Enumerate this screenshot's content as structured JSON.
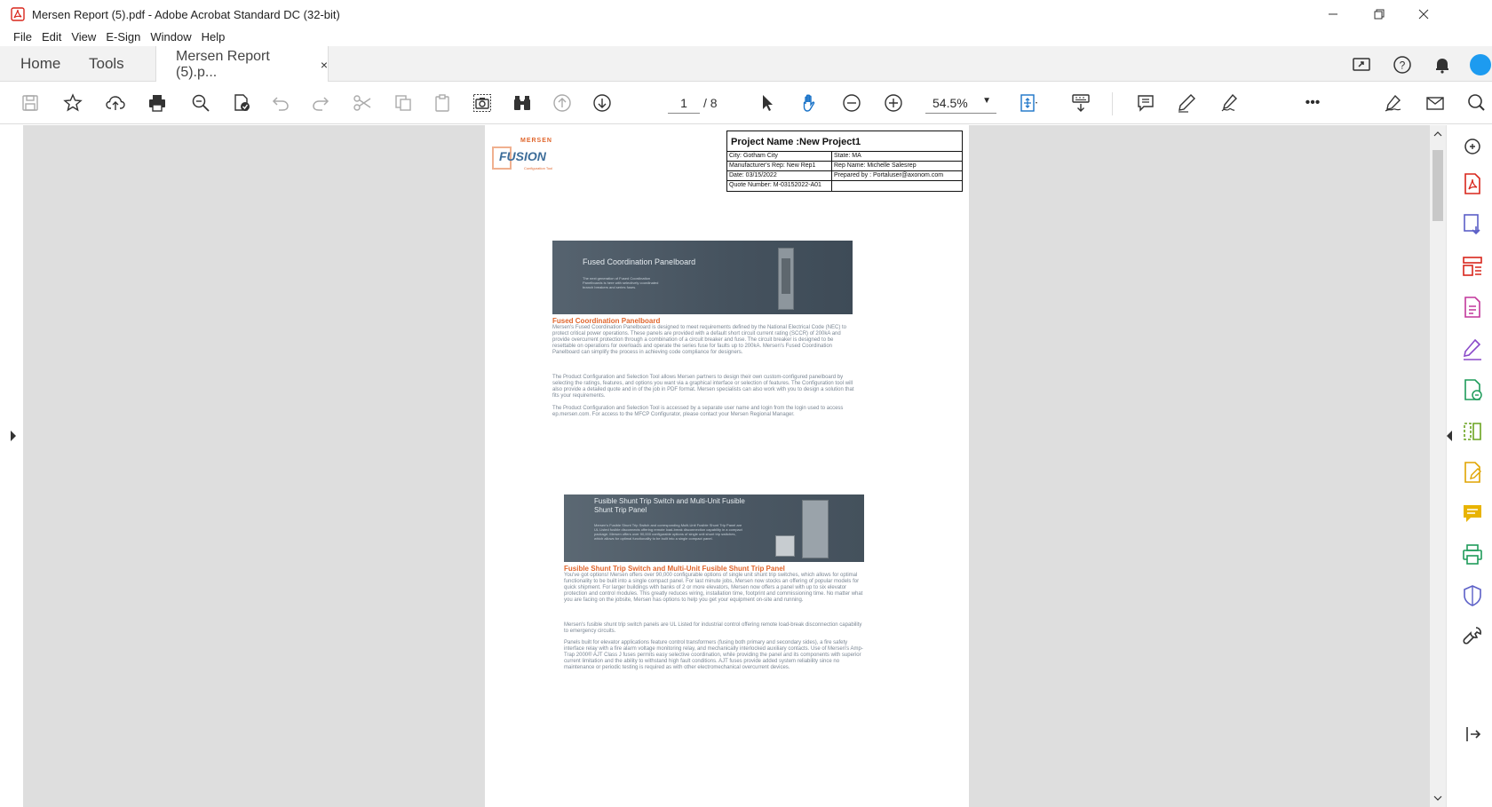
{
  "window": {
    "title": "Mersen Report (5).pdf - Adobe Acrobat Standard DC (32-bit)"
  },
  "menu": [
    "File",
    "Edit",
    "View",
    "E-Sign",
    "Window",
    "Help"
  ],
  "tabs": {
    "home": "Home",
    "tools": "Tools",
    "document": "Mersen Report (5).p...",
    "close": "×"
  },
  "toolbar": {
    "page_current": "1",
    "page_total": "/ 8",
    "zoom": "54.5%",
    "more": "•••"
  },
  "colors": {
    "accent_orange": "#e0662d",
    "banner": "#4d5a66",
    "viewport": "#dedede"
  },
  "document": {
    "logo": {
      "brand": "MERSEN",
      "product": "FUSION",
      "sub": "Configuration Tool"
    },
    "project": {
      "title": "Project Name :New Project1",
      "rows": [
        [
          "City: Gotham City",
          "State: MA"
        ],
        [
          "Manufacturer's Rep: New Rep1",
          "Rep Name: Michelle Salesrep"
        ],
        [
          "Date: 03/15/2022",
          "Prepared by : Portaluser@axonom.com"
        ],
        [
          "Quote Number: M-03152022-A01",
          ""
        ]
      ]
    },
    "section1": {
      "banner_title": "Fused Coordination Panelboard",
      "banner_text": "The next generation of Fused Coordination Panelboards is here with selectively coordinated branch breakers and series fuses.",
      "title": "Fused Coordination Panelboard",
      "p1": "Mersen's Fused Coordination Panelboard is designed to meet requirements defined by the National Electrical Code (NEC) to protect critical power operations. These panels are provided with a default short circuit current rating (SCCR) of 200kA and provide overcurrent protection through a combination of a circuit breaker and fuse. The circuit breaker is designed to be resettable on operations for overloads and operate the series fuse for faults up to 200kA. Mersen's Fused Coordination Panelboard can simplify the process in achieving code compliance for designers.",
      "p2": "The Product Configuration and Selection Tool allows Mersen partners to design their own custom-configured panelboard by selecting the ratings, features, and options you want via a graphical interface or selection of features. The Configuration tool will also provide a detailed quote and in of the job in PDF format. Mersen specialists can also work with you to design a solution that fits your requirements.",
      "p3": "The Product Configuration and Selection Tool is accessed by a separate user name and login from the login used to access ep.mersen.com. For access to the MFCP Configurator, please contact your Mersen Regional Manager."
    },
    "section2": {
      "banner_title": "Fusible Shunt Trip Switch and Multi-Unit Fusible Shunt Trip Panel",
      "banner_text": "Mersen's Fusible Shunt Trip Switch and corresponding Multi-Unit Fusible Shunt Trip Panel are UL Listed fusible disconnects offering remote load-break disconnection capability in a compact package. Mersen offers over 90,000 configurable options of single unit shunt trip switches, which allows for optimal functionality to be built into a single compact panel.",
      "title": "Fusible Shunt Trip Switch and Multi-Unit Fusible Shunt Trip Panel",
      "p1": "You've got options! Mersen offers over 90,000 configurable options of single unit shunt trip switches, which allows for optimal functionality to be built into a single compact panel. For last minute jobs, Mersen now stocks an offering of popular models for quick shipment. For larger buildings with banks of 2 or more elevators, Mersen now offers a panel with up to six elevator protection and control modules. This greatly reduces wiring, installation time, footprint and commissioning time. No matter what you are facing on the jobsite, Mersen has options to help you get your equipment on-site and running.",
      "p2": "Mersen's fusible shunt trip switch panels are UL Listed for industrial control offering remote load-break disconnection capability to emergency circuits.",
      "p3": "Panels built for elevator applications feature control transformers (fusing both primary and secondary sides), a fire safety interface relay with a fire alarm voltage monitoring relay, and mechanically interlocked auxiliary contacts. Use of Mersen's Amp-Trap 2000® AJT Class J fuses permits easy selective coordination, while providing the panel and its components with superior current limitation and the ability to withstand high fault conditions. AJT fuses provide added system reliability since no maintenance or periodic testing is required as with other electromechanical overcurrent devices."
    }
  }
}
